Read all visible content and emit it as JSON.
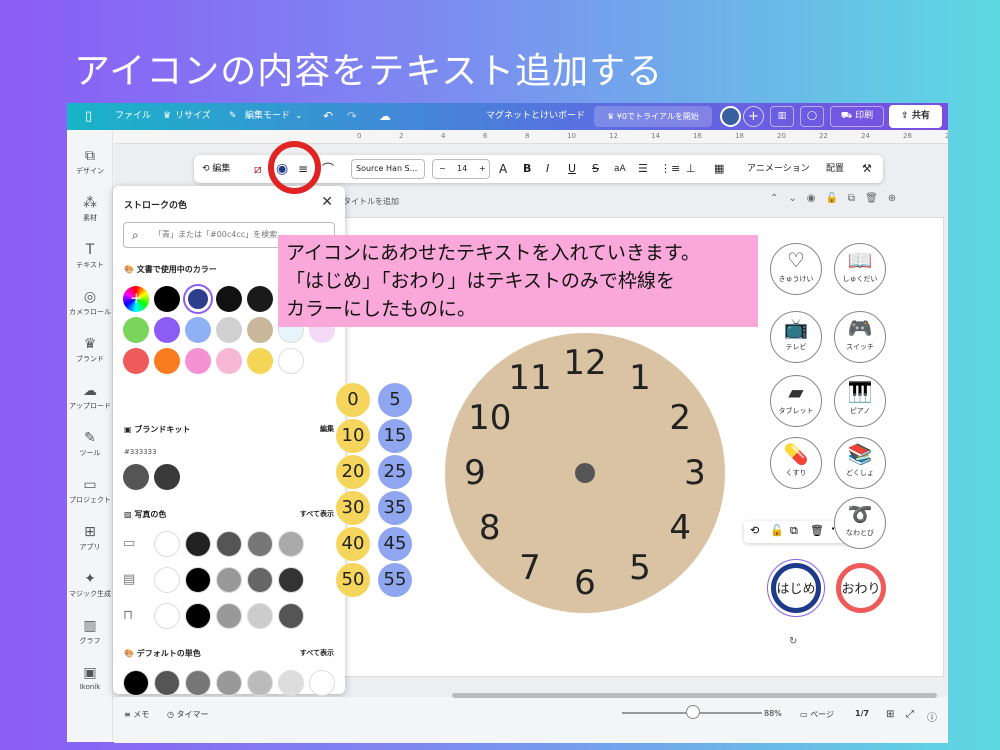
{
  "slide_title": "アイコンの内容をテキスト追加する",
  "topbar": {
    "menu_icon": "panel-icon",
    "file": "ファイル",
    "resize": "リサイズ",
    "edit_mode": "編集モード",
    "doc_title": "マグネットとけいボード",
    "trial": "¥0でトライアルを開始",
    "print": "印刷",
    "share": "共有"
  },
  "sidebar": [
    {
      "icon": "⧉",
      "label": "デザイン"
    },
    {
      "icon": "⁂",
      "label": "素材"
    },
    {
      "icon": "T",
      "label": "テキスト"
    },
    {
      "icon": "◎",
      "label": "カメラロール"
    },
    {
      "icon": "♛",
      "label": "ブランド"
    },
    {
      "icon": "☁",
      "label": "アップロード"
    },
    {
      "icon": "✎",
      "label": "ツール"
    },
    {
      "icon": "▭",
      "label": "プロジェクト"
    },
    {
      "icon": "⊞",
      "label": "アプリ"
    },
    {
      "icon": "✦",
      "label": "マジック生成"
    },
    {
      "icon": "▥",
      "label": "グラフ"
    },
    {
      "icon": "▣",
      "label": "Ikonik"
    }
  ],
  "ruler": [
    "0",
    "2",
    "4",
    "6",
    "8",
    "10",
    "12",
    "14",
    "16",
    "18",
    "20",
    "22",
    "24",
    "26",
    "28",
    "30"
  ],
  "toolbar": {
    "edit": "編集",
    "font": "Source Han S...",
    "size": "14",
    "minus": "−",
    "plus": "+",
    "animation": "アニメーション",
    "arrange": "配置"
  },
  "page_title_placeholder": "タイトルを追加",
  "stroke_panel": {
    "title": "ストロークの色",
    "search_placeholder": "「青」または「#00c4cc」を検索",
    "doc_colors_label": "文書で使用中のカラー",
    "brand_kit_label": "ブランドキット",
    "brand_edit": "編集",
    "brand_hex": "#333333",
    "photo_colors_label": "写真の色",
    "show_all": "すべて表示",
    "default_colors_label": "デフォルトの単色",
    "doc_colors": [
      "#000000",
      "#2d3e8c",
      "#111111",
      "#1a1a1a",
      "#555555",
      "#555555",
      "#7bd45b",
      "#8b5cf6",
      "#8fb0f5",
      "#d1d1d1",
      "#c8b79a",
      "#e8f4fb",
      "#f3d9f5",
      "#ef5a5a",
      "#f97d1e",
      "#f391d3",
      "#f6b8d4",
      "#f5d556",
      "#ffffff"
    ],
    "brand_colors": [
      "#555555",
      "#3a3a3a"
    ],
    "photo_rows": [
      [
        "#ffffff",
        "#222222",
        "#555555",
        "#777777",
        "#aaaaaa"
      ],
      [
        "#ffffff",
        "#000000",
        "#999999",
        "#666666",
        "#333333"
      ],
      [
        "#ffffff",
        "#000000",
        "#999999",
        "#cccccc",
        "#555555"
      ]
    ],
    "default_colors": [
      "#000000",
      "#555555",
      "#777777",
      "#999999",
      "#bbbbbb",
      "#dddddd",
      "#ffffff"
    ]
  },
  "callout": {
    "line1": "アイコンにあわせたテキストを入れていきます。",
    "line2": "「はじめ」「おわり」はテキストのみで枠線を",
    "line3": "カラーにしたものに。"
  },
  "clock_numbers": [
    "12",
    "1",
    "2",
    "3",
    "4",
    "5",
    "6",
    "7",
    "8",
    "9",
    "10",
    "11"
  ],
  "minute_pills_left": [
    "0",
    "10",
    "20",
    "30",
    "40",
    "50"
  ],
  "minute_pills_right": [
    "5",
    "15",
    "25",
    "35",
    "45",
    "55"
  ],
  "icons": [
    {
      "glyph": "♡",
      "label": "きゅうけい"
    },
    {
      "glyph": "📖",
      "label": "しゅくだい"
    },
    {
      "glyph": "📺",
      "label": "テレビ"
    },
    {
      "glyph": "🎮",
      "label": "スイッチ"
    },
    {
      "glyph": "▰",
      "label": "タブレット"
    },
    {
      "glyph": "🎹",
      "label": "ピアノ"
    },
    {
      "glyph": "💊",
      "label": "くすり"
    },
    {
      "glyph": "📚",
      "label": "どくしょ"
    },
    {
      "glyph": "➰",
      "label": "なわとび"
    }
  ],
  "start_label": "はじめ",
  "end_label": "おわり",
  "colors": {
    "start_ring": "#1e3a8a",
    "end_ring": "#ef4444",
    "highlight": "#e02424"
  },
  "bottombar": {
    "memo": "メモ",
    "timer": "タイマー",
    "zoom": "88%",
    "pages": "ページ",
    "page_count": "1/7"
  }
}
